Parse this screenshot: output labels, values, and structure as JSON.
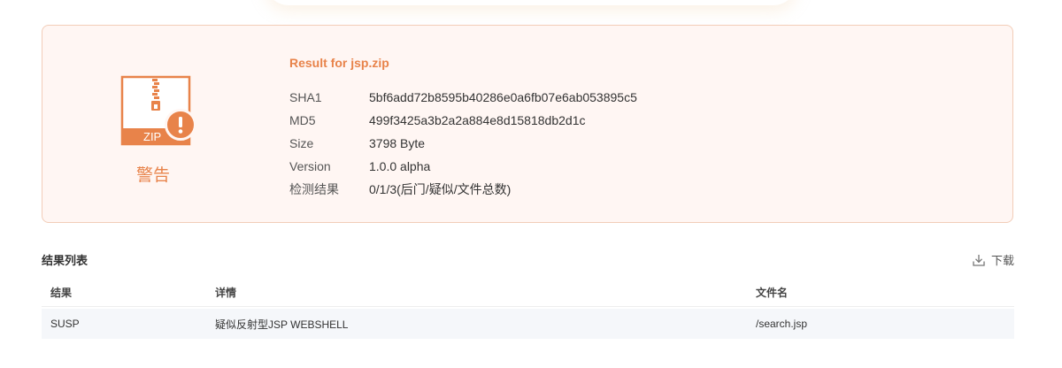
{
  "result": {
    "title": "Result for jsp.zip",
    "file_type_label": "ZIP",
    "verdict": "警告",
    "info": [
      {
        "key": "SHA1",
        "value": "5bf6add72b8595b40286e0a6fb07e6ab053895c5"
      },
      {
        "key": "MD5",
        "value": "499f3425a3b2a2a884e8d15818db2d1c"
      },
      {
        "key": "Size",
        "value": "3798 Byte"
      },
      {
        "key": "Version",
        "value": "1.0.0 alpha"
      },
      {
        "key": "检测结果",
        "value": "0/1/3(后门/疑似/文件总数)"
      }
    ]
  },
  "list": {
    "title": "结果列表",
    "download_label": "下载",
    "columns": [
      "结果",
      "详情",
      "文件名"
    ],
    "rows": [
      {
        "result": "SUSP",
        "detail": "疑似反射型JSP WEBSHELL",
        "filename": "/search.jsp"
      }
    ]
  },
  "colors": {
    "accent": "#e8834a",
    "card_bg": "#fff6f3",
    "card_border": "#f2cdb8",
    "row_bg": "#f5f7fa"
  },
  "icons": {
    "file": "zip-file-icon",
    "warning": "exclamation-icon",
    "download": "download-icon"
  }
}
